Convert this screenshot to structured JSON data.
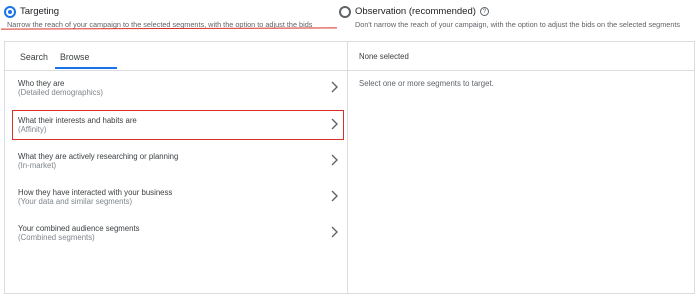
{
  "targeting_options": {
    "targeting": {
      "title": "Targeting",
      "description": "Narrow the reach of your campaign to the selected segments, with the option to adjust the bids",
      "selected": true
    },
    "observation": {
      "title": "Observation (recommended)",
      "description": "Don't narrow the reach of your campaign, with the option to adjust the bids on the selected segments",
      "selected": false,
      "help_icon": "question-circle-icon"
    }
  },
  "tabs": [
    {
      "label": "Search",
      "active": false
    },
    {
      "label": "Browse",
      "active": true
    }
  ],
  "browse_items": [
    {
      "title": "Who they are",
      "subtitle": "(Detailed demographics)"
    },
    {
      "title": "What their interests and habits are",
      "subtitle": "(Affinity)"
    },
    {
      "title": "What they are actively researching or planning",
      "subtitle": "(In-market)"
    },
    {
      "title": "How they have interacted with your business",
      "subtitle": "(Your data and similar segments)"
    },
    {
      "title": "Your combined audience segments",
      "subtitle": "(Combined segments)"
    }
  ],
  "selection_panel": {
    "header": "None selected",
    "hint": "Select one or more segments to target."
  },
  "colors": {
    "accent": "#1a73e8",
    "annotation": "#d93025",
    "border": "#dadce0"
  }
}
